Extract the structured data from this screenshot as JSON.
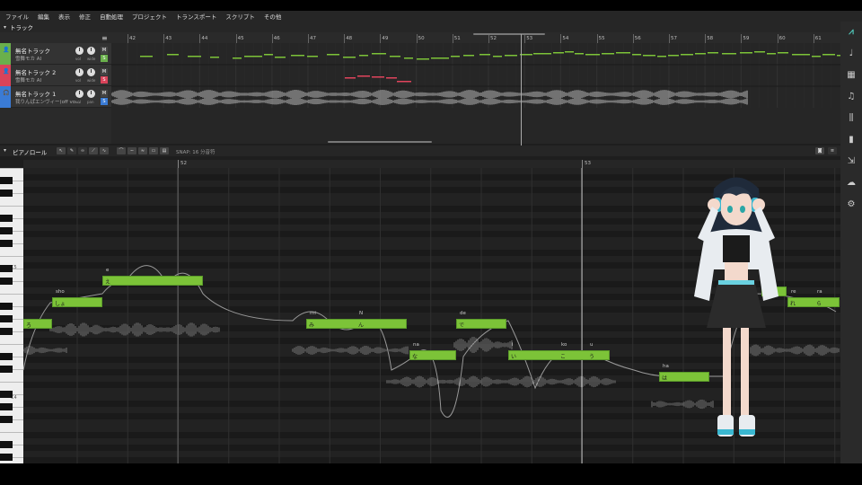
{
  "menu": [
    "ファイル",
    "編集",
    "表示",
    "修正",
    "自動処理",
    "プロジェクト",
    "トランスポート",
    "スクリプト",
    "その他"
  ],
  "track_panel": {
    "title": "トラック"
  },
  "ruler": {
    "bars": [
      "42",
      "43",
      "44",
      "45",
      "46",
      "47",
      "48",
      "49",
      "50",
      "51",
      "52",
      "53",
      "54",
      "55",
      "56",
      "57",
      "58",
      "59",
      "60",
      "61"
    ]
  },
  "tracks": [
    {
      "name": "無名トラック",
      "voice": "雪舞モカ AI",
      "color": "#6ab04c",
      "mute": "M",
      "solo": "S"
    },
    {
      "name": "無名トラック 2",
      "voice": "雪舞モカ AI",
      "color": "#d9435a",
      "mute": "M",
      "solo": "S"
    },
    {
      "name": "無名トラック 1",
      "voice": "我りんぱエンヴィー(off vo...",
      "color": "#3a7bd5",
      "mute": "M",
      "solo": "S"
    }
  ],
  "knob_labels": {
    "vol": "vol",
    "pan": "pan",
    "wide": "wide"
  },
  "pianoroll": {
    "title": "ピアノロール",
    "snap": "SNAP: 16 分音符",
    "bar_labels": [
      "52",
      "53"
    ],
    "key_labels": [
      "C5",
      "C4"
    ]
  },
  "notes": [
    {
      "lyric": "ろ",
      "phoneme": ""
    },
    {
      "lyric": "しょ",
      "phoneme": "sho"
    },
    {
      "lyric": "え",
      "phoneme": "e"
    },
    {
      "lyric": "み",
      "phoneme": "mi"
    },
    {
      "lyric": "ん",
      "phoneme": "N"
    },
    {
      "lyric": "な",
      "phoneme": "na"
    },
    {
      "lyric": "で",
      "phoneme": "de"
    },
    {
      "lyric": "い",
      "phoneme": "i"
    },
    {
      "lyric": "こ",
      "phoneme": "ko"
    },
    {
      "lyric": "う",
      "phoneme": "u"
    },
    {
      "lyric": "は",
      "phoneme": "ha"
    },
    {
      "lyric": "し",
      "phoneme": "shi"
    },
    {
      "lyric": "れ",
      "phoneme": "re"
    },
    {
      "lyric": "ら",
      "phoneme": "ra"
    }
  ],
  "colors": {
    "note_green": "#7cc338",
    "note_red": "#e0445c",
    "bg": "#1e1e1e"
  },
  "icons": [
    "logo-icon",
    "mic-icon",
    "keyboard-icon",
    "music-note-icon",
    "library-icon",
    "book-icon",
    "export-icon",
    "cloud-icon",
    "gear-icon"
  ]
}
